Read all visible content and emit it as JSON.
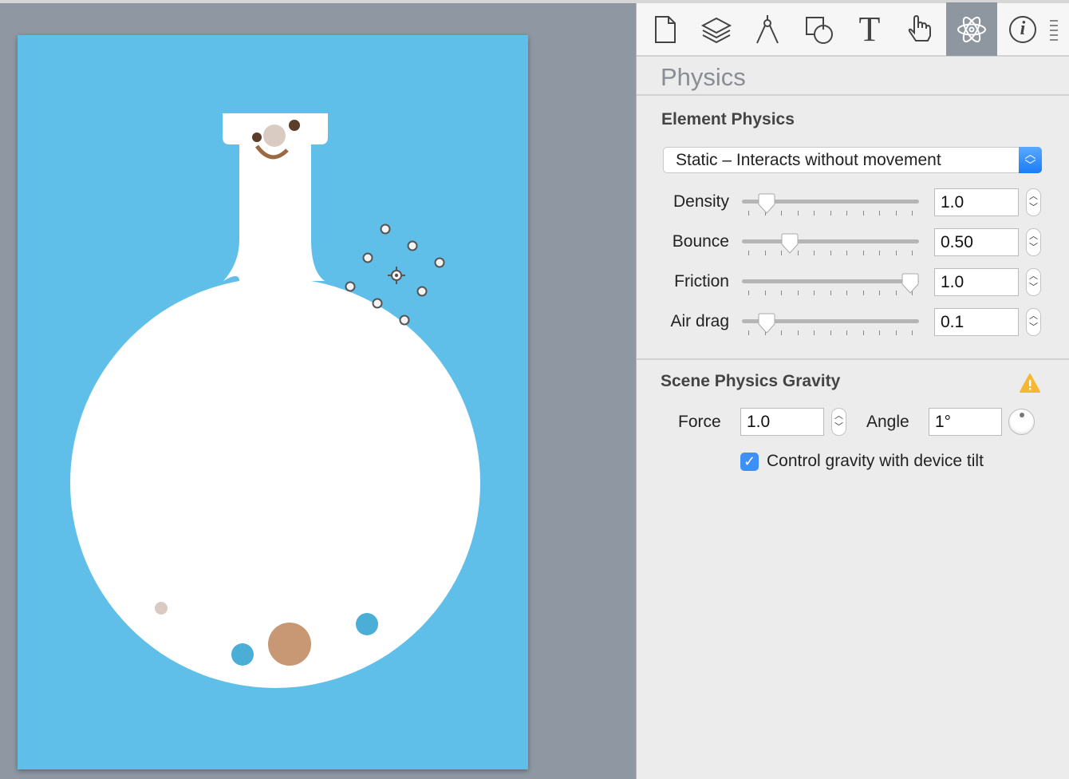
{
  "toolbar": {
    "tabs": [
      {
        "icon": "document-icon",
        "active": false
      },
      {
        "icon": "layers-icon",
        "active": false
      },
      {
        "icon": "compass-icon",
        "active": false
      },
      {
        "icon": "shapes-icon",
        "active": false
      },
      {
        "icon": "text-icon",
        "active": false
      },
      {
        "icon": "hand-icon",
        "active": false
      },
      {
        "icon": "atom-icon",
        "active": true
      },
      {
        "icon": "info-icon",
        "active": false
      }
    ],
    "text_glyph": "T",
    "info_glyph": "i"
  },
  "panel": {
    "title": "Physics",
    "element_physics": {
      "heading": "Element Physics",
      "body_type": "Static – Interacts without movement",
      "properties": [
        {
          "label": "Density",
          "value": "1.0",
          "slider_percent": 14
        },
        {
          "label": "Bounce",
          "value": "0.50",
          "slider_percent": 27
        },
        {
          "label": "Friction",
          "value": "1.0",
          "slider_percent": 95
        },
        {
          "label": "Air drag",
          "value": "0.1",
          "slider_percent": 14
        }
      ]
    },
    "gravity": {
      "heading": "Scene Physics Gravity",
      "force_label": "Force",
      "force": "1.0",
      "angle_label": "Angle",
      "angle": "1°",
      "tilt_label": "Control gravity with device tilt",
      "tilt_checked": true,
      "warning": true
    }
  },
  "colors": {
    "canvas": "#5fbfe9",
    "flask": "#ffffff",
    "accent": "#3e8ff6",
    "active_tab": "#8e96a0",
    "ball_blue": "#4aaed6",
    "ball_tan": "#c79873",
    "ball_beige": "#d9cbc1",
    "warning": "#f5b830"
  }
}
